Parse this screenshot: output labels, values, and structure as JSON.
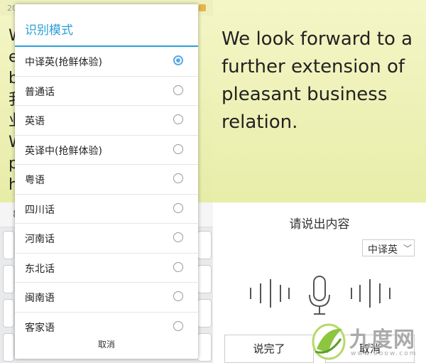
{
  "note": {
    "date_prefix": "20",
    "peek_chars": [
      "W",
      "e",
      "b",
      "我",
      "业",
      "W",
      "p",
      "h"
    ],
    "body": "We look forward to a further extension of pleasant business relation."
  },
  "keyboard_strip_char": "8",
  "dialog": {
    "title": "识别模式",
    "options": [
      {
        "label": "中译英(抢鲜体验)",
        "checked": true
      },
      {
        "label": "普通话",
        "checked": false
      },
      {
        "label": "英语",
        "checked": false
      },
      {
        "label": "英译中(抢鲜体验)",
        "checked": false
      },
      {
        "label": "粤语",
        "checked": false
      },
      {
        "label": "四川话",
        "checked": false
      },
      {
        "label": "河南话",
        "checked": false
      },
      {
        "label": "东北话",
        "checked": false
      },
      {
        "label": "闽南语",
        "checked": false
      },
      {
        "label": "客家语",
        "checked": false
      }
    ],
    "cancel": "取消"
  },
  "voice": {
    "title": "请说出内容",
    "lang": "中译英",
    "done_button": "说完了",
    "cancel_button": "取消"
  },
  "watermark": {
    "text": "九度网",
    "sub": "www.9oow.com"
  },
  "colors": {
    "accent": "#2a9fd8",
    "note": "#eef1b8",
    "radio": "#5aa9e6"
  }
}
